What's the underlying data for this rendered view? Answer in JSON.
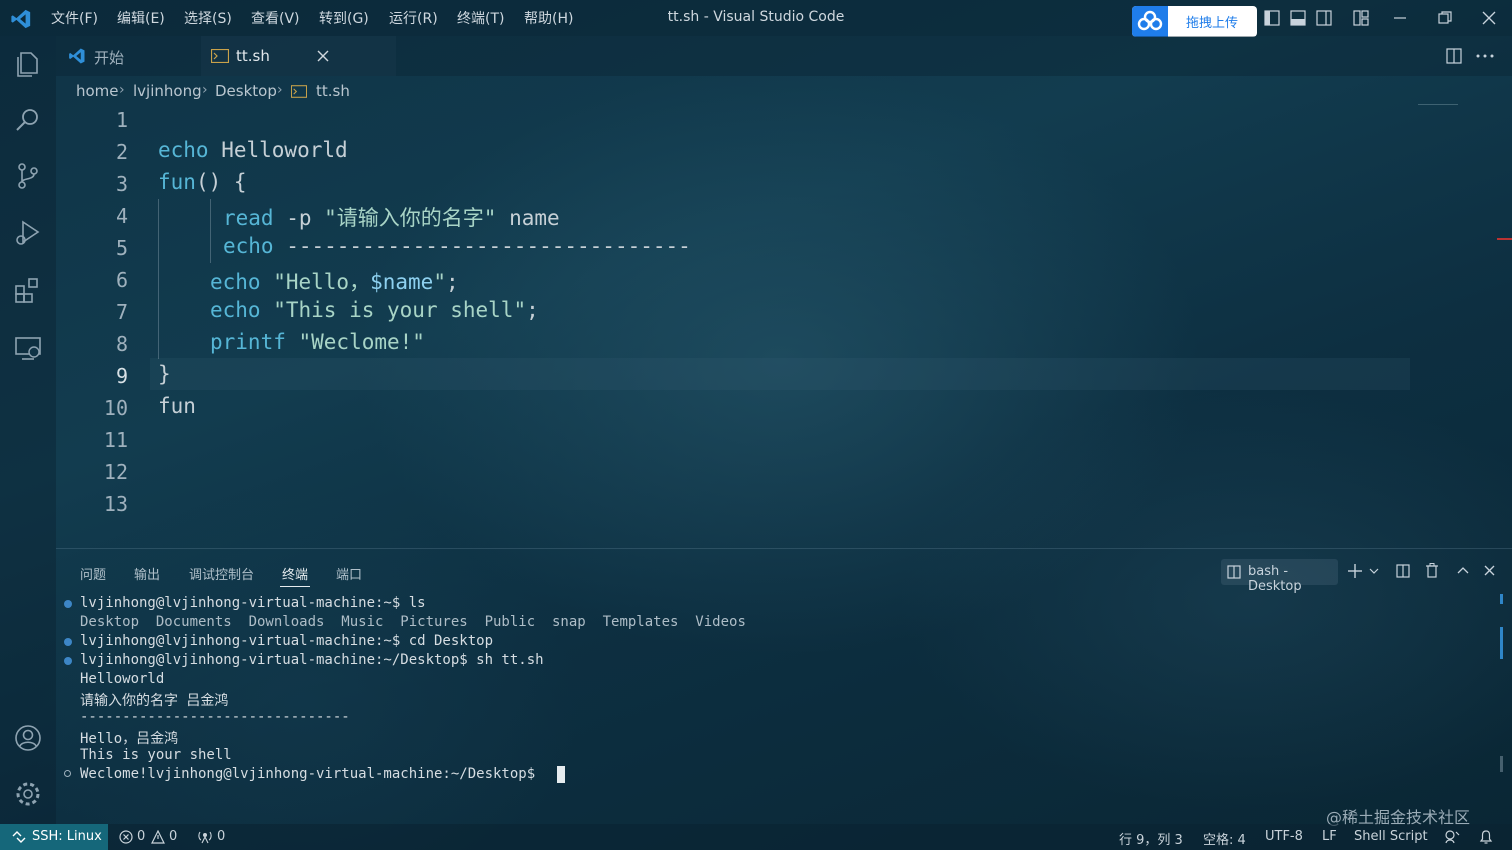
{
  "titlebar": {
    "menu": [
      "文件(F)",
      "编辑(E)",
      "选择(S)",
      "查看(V)",
      "转到(G)",
      "运行(R)",
      "终端(T)",
      "帮助(H)"
    ],
    "window_title": "tt.sh - Visual Studio Code",
    "upload_button": "拖拽上传"
  },
  "tabs": {
    "start": "开始",
    "active": "tt.sh"
  },
  "breadcrumb": [
    "home",
    "lvjinhong",
    "Desktop",
    "tt.sh"
  ],
  "editor": {
    "line_numbers": [
      "1",
      "2",
      "3",
      "4",
      "5",
      "6",
      "7",
      "8",
      "9",
      "10",
      "11",
      "12",
      "13"
    ],
    "lines": {
      "l2_kw": "echo",
      "l2_txt": " Helloworld",
      "l3_kw": "fun",
      "l3_txt": "() {",
      "l4_kw": "read",
      "l4_opt": " -p ",
      "l4_str": "\"请输入你的名字\"",
      "l4_txt": " name",
      "l5_kw": "echo",
      "l5_txt": " --------------------------------",
      "l6_kw": "echo",
      "l6_str1": " \"Hello，",
      "l6_var": "$name",
      "l6_str2": "\"",
      "l6_txt": ";",
      "l7_kw": "echo",
      "l7_str": " \"This is your shell\"",
      "l7_txt": ";",
      "l8_kw": "printf",
      "l8_str": " \"Weclome!\"",
      "l9_txt": "}",
      "l10_txt": "fun"
    }
  },
  "panel": {
    "tabs": [
      "问题",
      "输出",
      "调试控制台",
      "终端",
      "端口"
    ],
    "active_tab": "终端",
    "terminal_name": "bash - Desktop",
    "terminal_lines": [
      "lvjinhong@lvjinhong-virtual-machine:~$ ls",
      "Desktop  Documents  Downloads  Music  Pictures  Public  snap  Templates  Videos",
      "lvjinhong@lvjinhong-virtual-machine:~$ cd Desktop",
      "lvjinhong@lvjinhong-virtual-machine:~/Desktop$ sh tt.sh",
      "Helloworld",
      "请输入你的名字 吕金鸿",
      "--------------------------------",
      "Hello，吕金鸿",
      "This is your shell",
      "Weclome!lvjinhong@lvjinhong-virtual-machine:~/Desktop$ "
    ]
  },
  "statusbar": {
    "remote": "SSH: Linux",
    "errors": "0",
    "warnings": "0",
    "ports": "0",
    "position": "行 9，列 3",
    "spaces": "空格: 4",
    "encoding": "UTF-8",
    "eol": "LF",
    "language": "Shell Script"
  },
  "watermark": "@稀土掘金技术社区",
  "colors": {
    "accent": "#1f7dea",
    "remote_bg": "#15677a",
    "keyword": "#56b6d6",
    "string": "#a8d4c6"
  }
}
